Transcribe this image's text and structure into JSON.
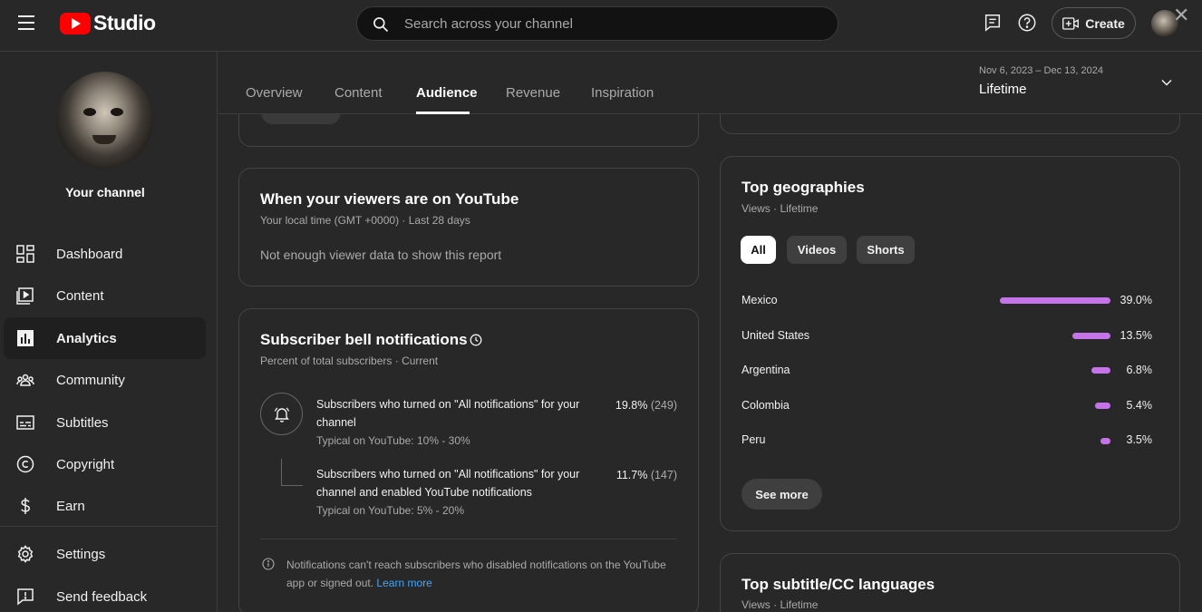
{
  "header": {
    "logo_text": "Studio",
    "search_placeholder": "Search across your channel",
    "create_label": "Create",
    "close_symbol": "✕"
  },
  "sidebar": {
    "channel_label": "Your channel",
    "items": [
      {
        "label": "Dashboard",
        "icon": "dashboard-icon"
      },
      {
        "label": "Content",
        "icon": "content-icon"
      },
      {
        "label": "Analytics",
        "icon": "analytics-icon",
        "active": true
      },
      {
        "label": "Community",
        "icon": "community-icon"
      },
      {
        "label": "Subtitles",
        "icon": "subtitles-icon"
      },
      {
        "label": "Copyright",
        "icon": "copyright-icon"
      },
      {
        "label": "Earn",
        "icon": "earn-icon"
      },
      {
        "label": "Settings",
        "icon": "gear-icon"
      },
      {
        "label": "Send feedback",
        "icon": "feedback-icon"
      }
    ]
  },
  "tabs": {
    "items": [
      "Overview",
      "Content",
      "Audience",
      "Revenue",
      "Inspiration"
    ],
    "active": "Audience"
  },
  "date": {
    "range": "Nov 6, 2023 – Dec 13, 2024",
    "label": "Lifetime"
  },
  "viewers_card": {
    "title": "When your viewers are on YouTube",
    "subtitle": "Your local time (GMT +0000) · Last 28 days",
    "empty_message": "Not enough viewer data to show this report"
  },
  "bell_card": {
    "title": "Subscriber bell notifications",
    "subtitle": "Percent of total subscribers · Current",
    "rows": [
      {
        "text": "Subscribers who turned on \"All notifications\" for your channel",
        "typical": "Typical on YouTube: 10% - 30%",
        "percent": "19.8%",
        "count": "(249)"
      },
      {
        "text": "Subscribers who turned on \"All notifications\" for your channel and enabled YouTube notifications",
        "typical": "Typical on YouTube: 5% - 20%",
        "percent": "11.7%",
        "count": "(147)"
      }
    ],
    "footnote": "Notifications can't reach subscribers who disabled notifications on the YouTube app or signed out.",
    "learn_more": "Learn more"
  },
  "geo_card": {
    "title": "Top geographies",
    "subtitle": "Views · Lifetime",
    "chips": [
      "All",
      "Videos",
      "Shorts"
    ],
    "selected_chip": "All",
    "rows": [
      {
        "name": "Mexico",
        "value": "39.0%",
        "pct": 39.0
      },
      {
        "name": "United States",
        "value": "13.5%",
        "pct": 13.5
      },
      {
        "name": "Argentina",
        "value": "6.8%",
        "pct": 6.8
      },
      {
        "name": "Colombia",
        "value": "5.4%",
        "pct": 5.4
      },
      {
        "name": "Peru",
        "value": "3.5%",
        "pct": 3.5
      }
    ],
    "see_more": "See more",
    "bar_color": "#c573e8"
  },
  "subtitle_card": {
    "title": "Top subtitle/CC languages",
    "subtitle": "Views · Lifetime"
  }
}
